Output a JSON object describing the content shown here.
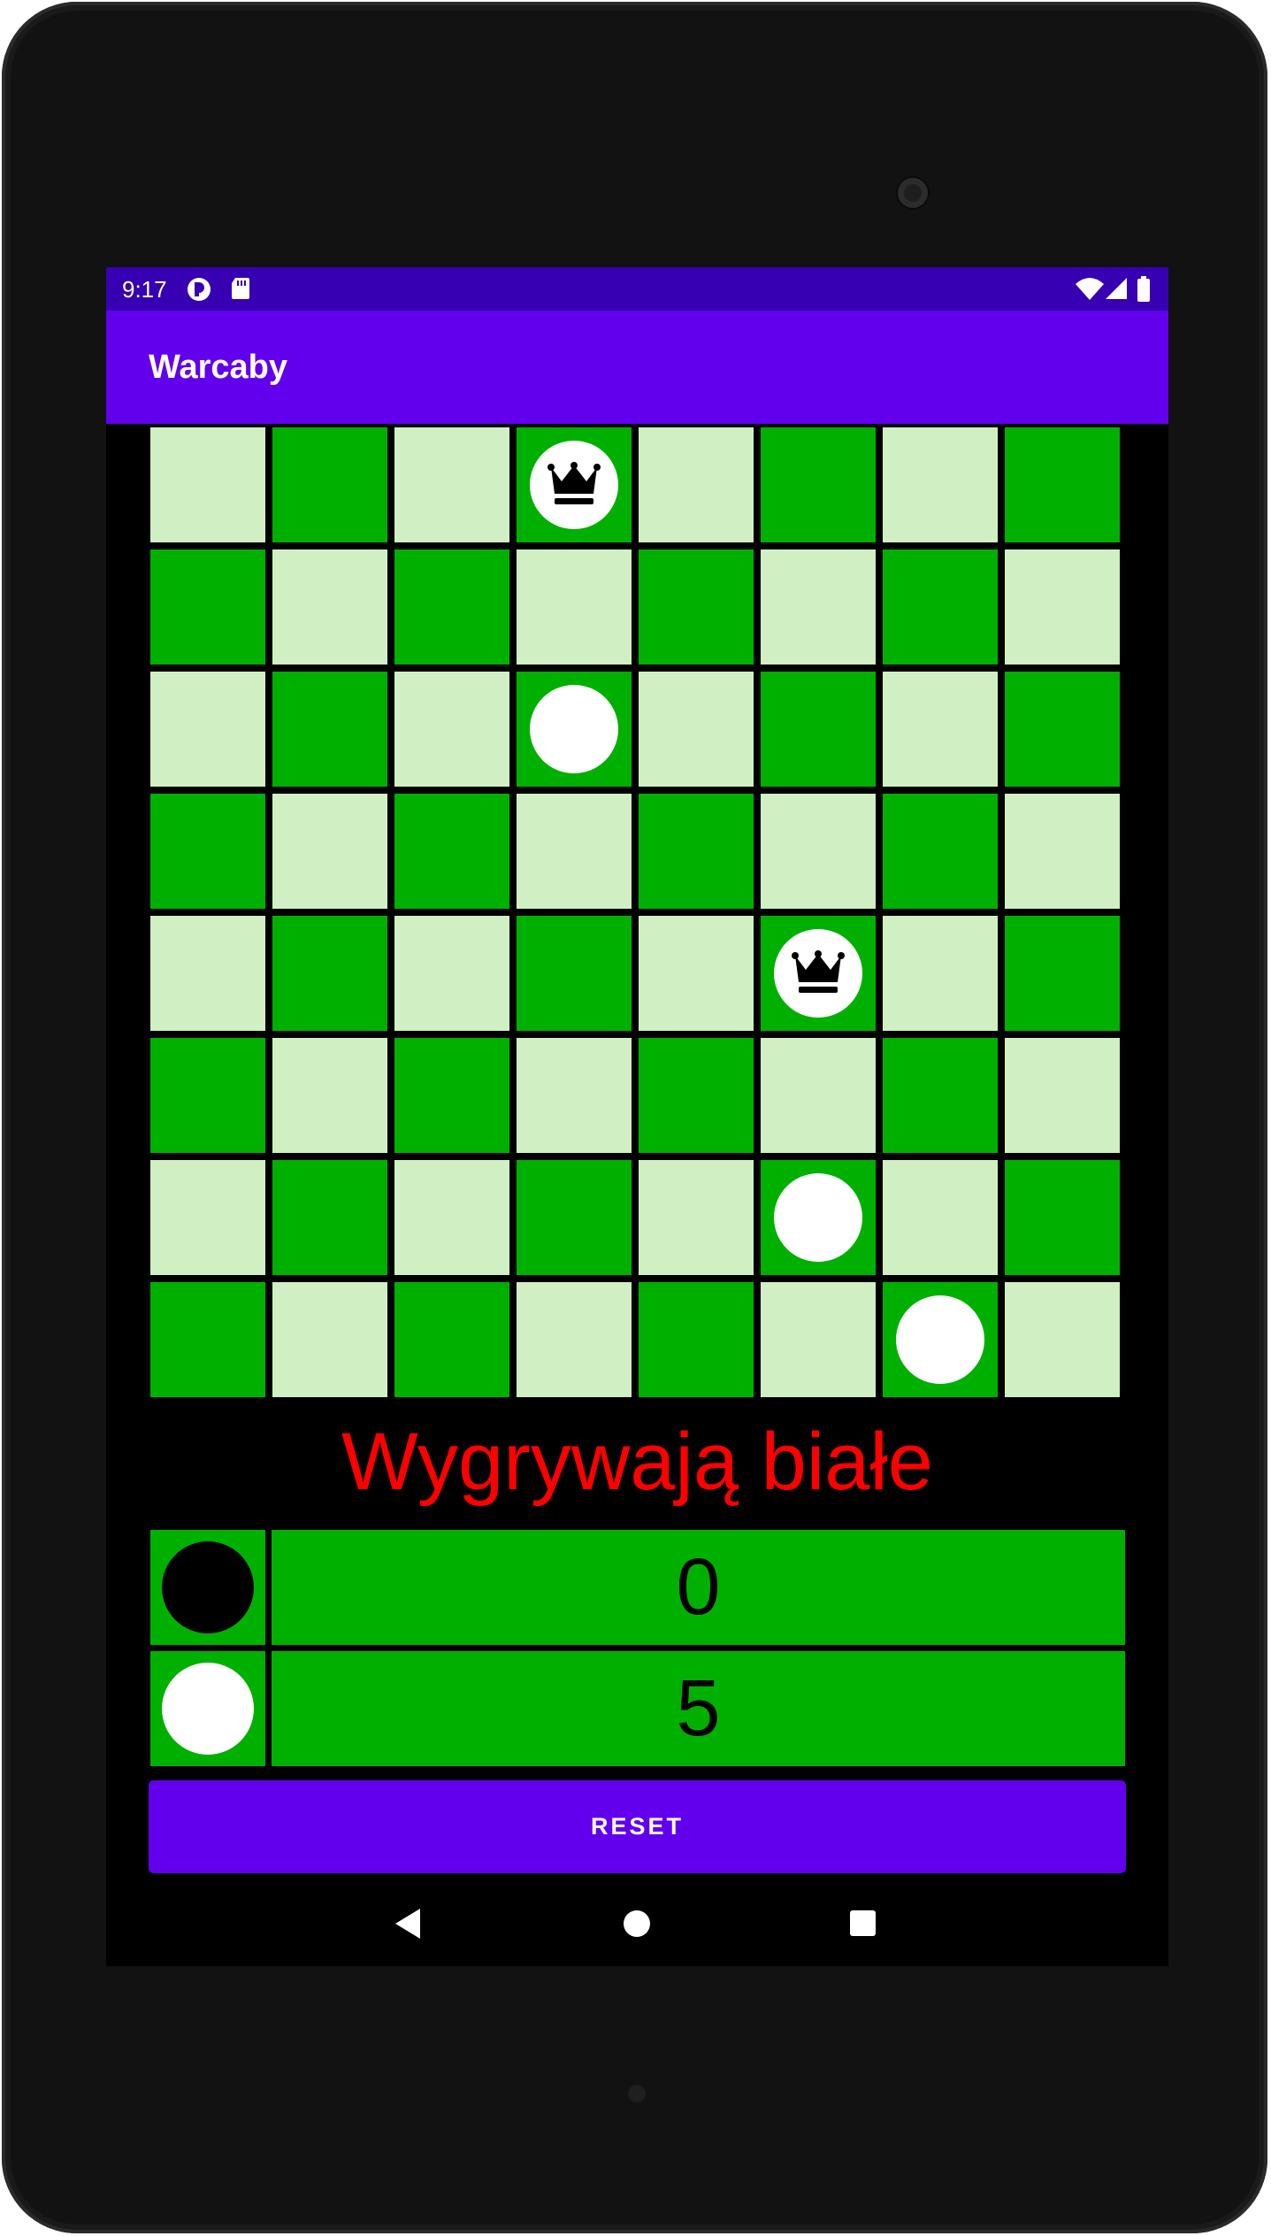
{
  "status_bar": {
    "time": "9:17"
  },
  "app_bar": {
    "title": "Warcaby"
  },
  "colors": {
    "light_square": "#d0efc3",
    "dark_square": "#00b000",
    "accent": "#6200ee",
    "status_bar": "#3700b3",
    "result_text": "#ff0000"
  },
  "board": {
    "size": 8,
    "pieces": [
      {
        "row": 0,
        "col": 3,
        "color": "white",
        "king": true
      },
      {
        "row": 2,
        "col": 3,
        "color": "white",
        "king": false
      },
      {
        "row": 4,
        "col": 5,
        "color": "white",
        "king": true
      },
      {
        "row": 6,
        "col": 5,
        "color": "white",
        "king": false
      },
      {
        "row": 7,
        "col": 6,
        "color": "white",
        "king": false
      }
    ]
  },
  "result": {
    "text": "Wygrywają białe"
  },
  "scores": [
    {
      "player": "black",
      "value": "0"
    },
    {
      "player": "white",
      "value": "5"
    }
  ],
  "reset_button": {
    "label": "RESET"
  },
  "nav": {
    "back": "back-icon",
    "home": "home-icon",
    "recents": "recents-icon"
  }
}
